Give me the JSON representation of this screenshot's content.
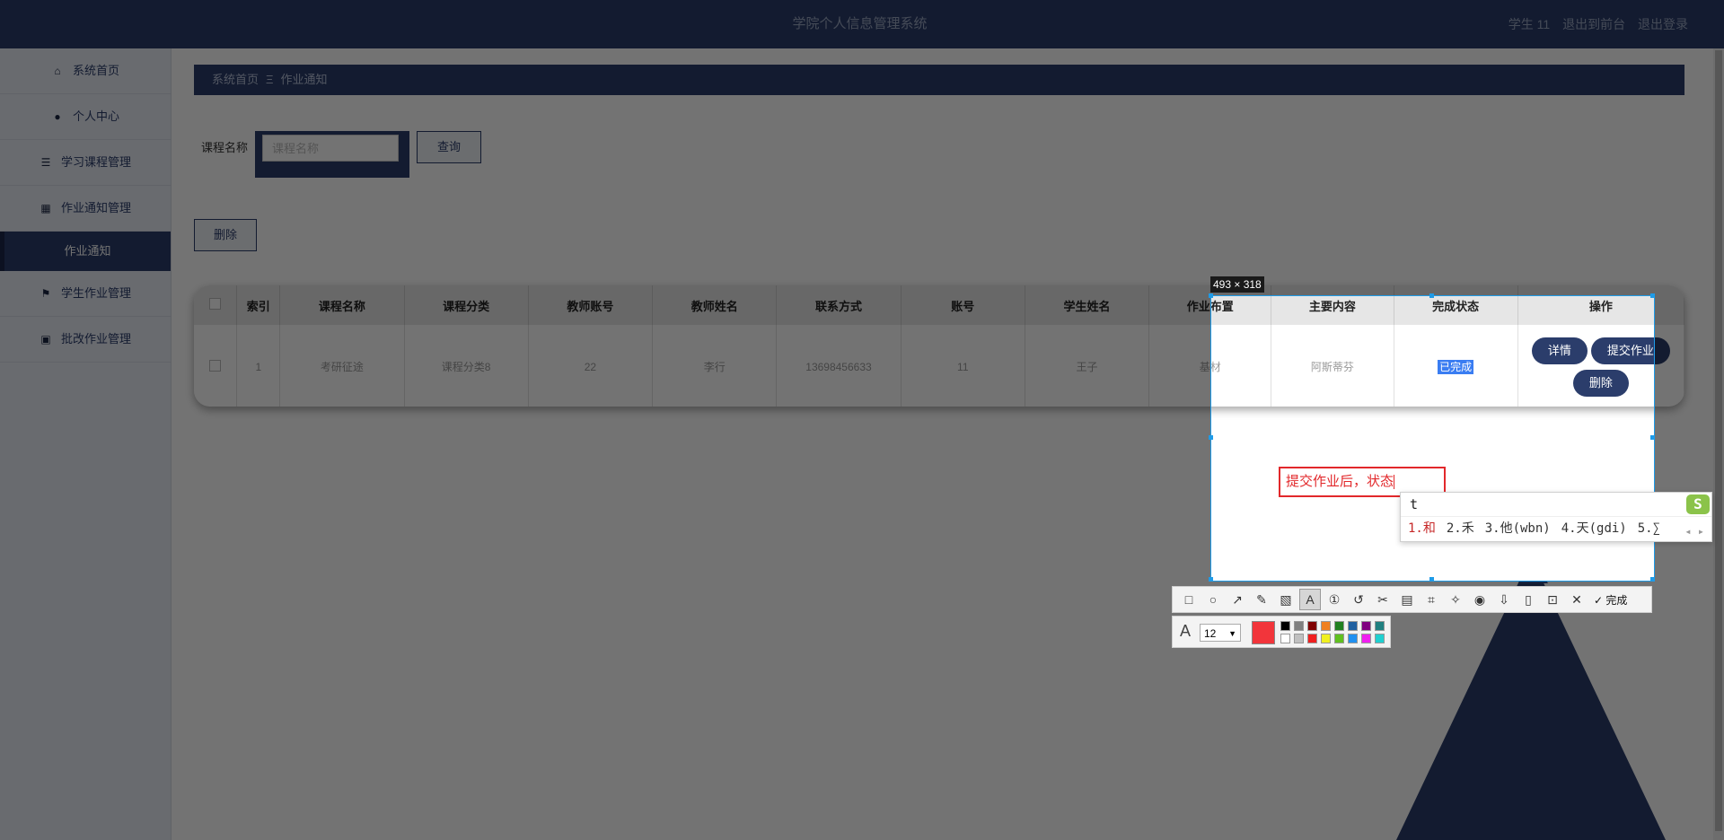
{
  "header": {
    "app_title": "学院个人信息管理系统",
    "user": "学生 11",
    "to_front": "退出到前台",
    "logout": "退出登录"
  },
  "sidebar": {
    "items": [
      {
        "label": "系统首页",
        "icon": "home-icon"
      },
      {
        "label": "个人中心",
        "icon": "user-icon"
      },
      {
        "label": "学习课程管理",
        "icon": "sliders-icon"
      },
      {
        "label": "作业通知管理",
        "icon": "grid-icon"
      },
      {
        "label": "作业通知",
        "icon": ""
      },
      {
        "label": "学生作业管理",
        "icon": "flag-icon"
      },
      {
        "label": "批改作业管理",
        "icon": "clipboard-icon"
      }
    ]
  },
  "breadcrumb": {
    "home": "系统首页",
    "separator": "Ξ",
    "current": "作业通知"
  },
  "search": {
    "label": "课程名称",
    "placeholder": "课程名称",
    "query_button": "查询"
  },
  "actions": {
    "delete_button": "删除"
  },
  "table": {
    "headers": [
      "索引",
      "课程名称",
      "课程分类",
      "教师账号",
      "教师姓名",
      "联系方式",
      "账号",
      "学生姓名",
      "作业布置",
      "主要内容",
      "完成状态",
      "操作"
    ],
    "rows": [
      {
        "index": "1",
        "course": "考研征途",
        "category": "课程分类8",
        "teacher_account": "22",
        "teacher_name": "李行",
        "phone": "13698456633",
        "account": "11",
        "student_name": "王子",
        "assignment": "基材",
        "content": "阿斯蒂芬",
        "status": "已完成",
        "ops": {
          "detail": "详情",
          "submit": "提交作业",
          "delete": "删除"
        }
      }
    ]
  },
  "capture_tool": {
    "size_badge": "493 × 318",
    "annotation_text": "提交作业后，状态",
    "ime": {
      "input": "t",
      "candidates": [
        "1.和",
        "2.禾",
        "3.他(wbn)",
        "4.天(gdi)",
        "5.∑"
      ],
      "logo": "S"
    },
    "toolbar_icons": [
      "rectangle-icon",
      "ellipse-icon",
      "arrow-icon",
      "pen-icon",
      "mosaic-icon",
      "text-icon",
      "number-icon",
      "undo-icon",
      "scissors-icon",
      "ocr-icon",
      "crop-icon",
      "pin-icon",
      "record-icon",
      "download-icon",
      "phone-icon",
      "bookmark-icon",
      "close-icon",
      "check-icon"
    ],
    "finish_label": "完成",
    "font_size": "12",
    "current_color": "#f2353b",
    "palette_colors": [
      "#000000",
      "#808080",
      "#800000",
      "#f08020",
      "#208020",
      "#2060a0",
      "#800080",
      "#208080",
      "#ffffff",
      "#c0c0c0",
      "#f02020",
      "#f0f020",
      "#60c020",
      "#2090f0",
      "#f020f0",
      "#20d0d0"
    ]
  }
}
